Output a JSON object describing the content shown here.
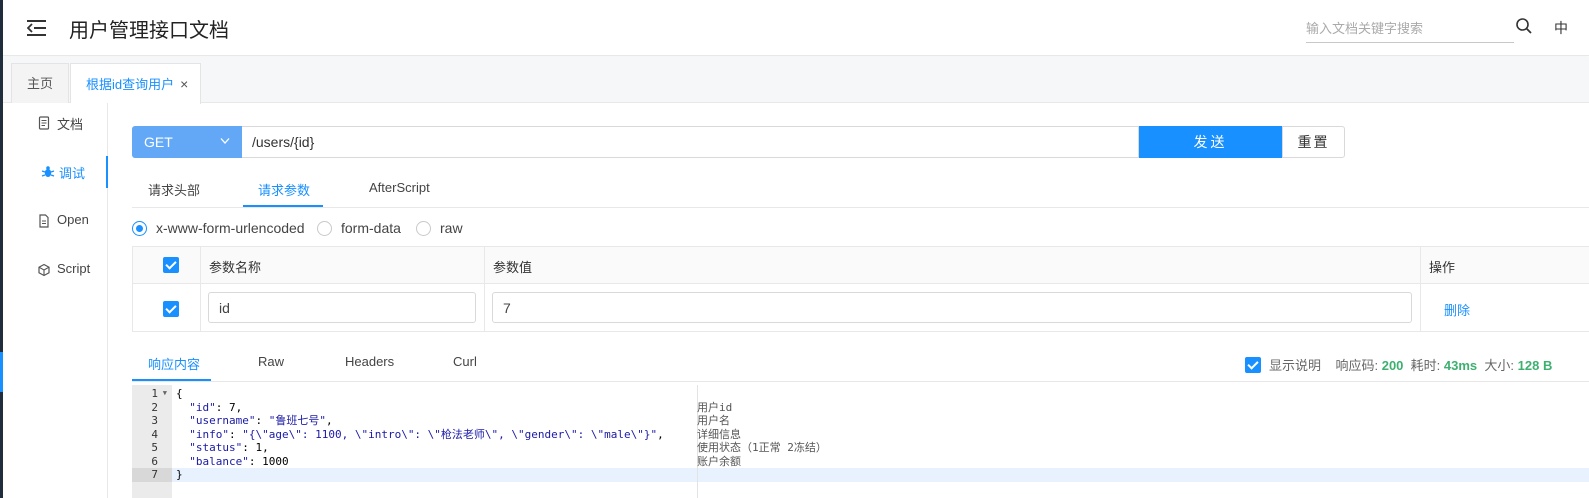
{
  "header": {
    "title": "用户管理接口文档",
    "search_placeholder": "输入文档关键字搜索",
    "lang": "中"
  },
  "tabs": [
    {
      "label": "主页"
    },
    {
      "label": "根据id查询用户",
      "close": "×"
    }
  ],
  "sidenav": [
    {
      "label": "文档",
      "icon": "document-icon"
    },
    {
      "label": "调试",
      "icon": "bug-icon"
    },
    {
      "label": "Open",
      "icon": "file-icon"
    },
    {
      "label": "Script",
      "icon": "cube-icon"
    }
  ],
  "request": {
    "method": "GET",
    "url": "/users/{id}",
    "send_label": "发送",
    "reset_label": "重置"
  },
  "request_tabs": [
    "请求头部",
    "请求参数",
    "AfterScript"
  ],
  "body_types": [
    "x-www-form-urlencoded",
    "form-data",
    "raw"
  ],
  "params_table": {
    "headers": [
      "参数名称",
      "参数值",
      "操作"
    ],
    "rows": [
      {
        "name": "id",
        "value": "7",
        "action": "删除"
      }
    ]
  },
  "response_tabs": [
    "响应内容",
    "Raw",
    "Headers",
    "Curl"
  ],
  "response_meta": {
    "show_desc_label": "显示说明",
    "code_label": "响应码:",
    "code": "200",
    "time_label": "耗时:",
    "time": "43ms",
    "size_label": "大小:",
    "size": "128 B"
  },
  "response_body": {
    "line_numbers": [
      "1",
      "2",
      "3",
      "4",
      "5",
      "6",
      "7"
    ],
    "brace_open": "{",
    "brace_close": "}",
    "fields": [
      {
        "key": "\"id\"",
        "value": "7",
        "sep": ",",
        "kind": "num",
        "desc": "用户id"
      },
      {
        "key": "\"username\"",
        "value": "\"鲁班七号\"",
        "sep": ",",
        "kind": "str",
        "desc": "用户名"
      },
      {
        "key": "\"info\"",
        "value": "\"{\\\"age\\\": 1100, \\\"intro\\\": \\\"枪法老师\\\", \\\"gender\\\": \\\"male\\\"}\"",
        "sep": ",",
        "kind": "str",
        "desc": "详细信息"
      },
      {
        "key": "\"status\"",
        "value": "1",
        "sep": ",",
        "kind": "num",
        "desc": "使用状态（1正常 2冻结）"
      },
      {
        "key": "\"balance\"",
        "value": "1000",
        "sep": "",
        "kind": "num",
        "desc": "账户余额"
      }
    ]
  }
}
